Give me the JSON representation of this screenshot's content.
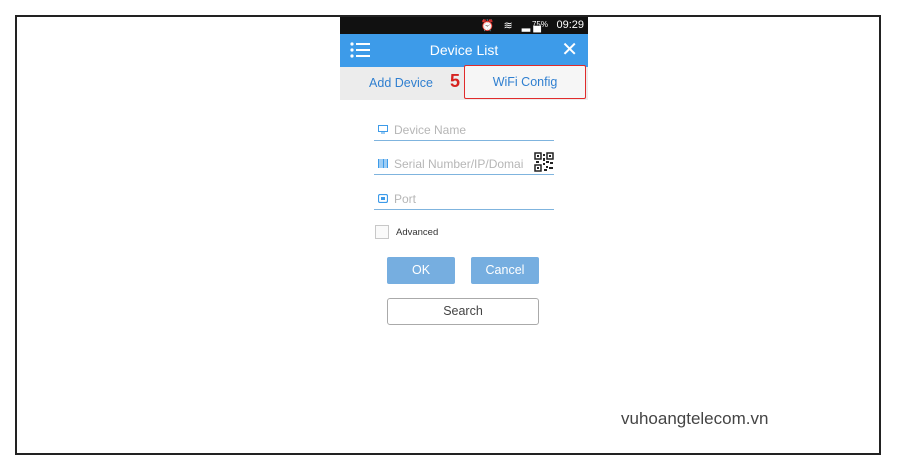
{
  "status_bar": {
    "battery": "75%",
    "time": "09:29"
  },
  "app_bar": {
    "title": "Device List"
  },
  "tabs": {
    "add_device": "Add Device",
    "step_marker": "5",
    "wifi_config": "WiFi Config"
  },
  "form": {
    "device_name_placeholder": "Device Name",
    "serial_placeholder": "Serial Number/IP/Domai",
    "port_placeholder": "Port",
    "advanced_label": "Advanced"
  },
  "buttons": {
    "ok": "OK",
    "cancel": "Cancel",
    "search": "Search"
  },
  "watermark": "vuhoangtelecom.vn",
  "colors": {
    "accent": "#3d9be9",
    "button": "#76aee0",
    "highlight": "#e02b2b"
  }
}
